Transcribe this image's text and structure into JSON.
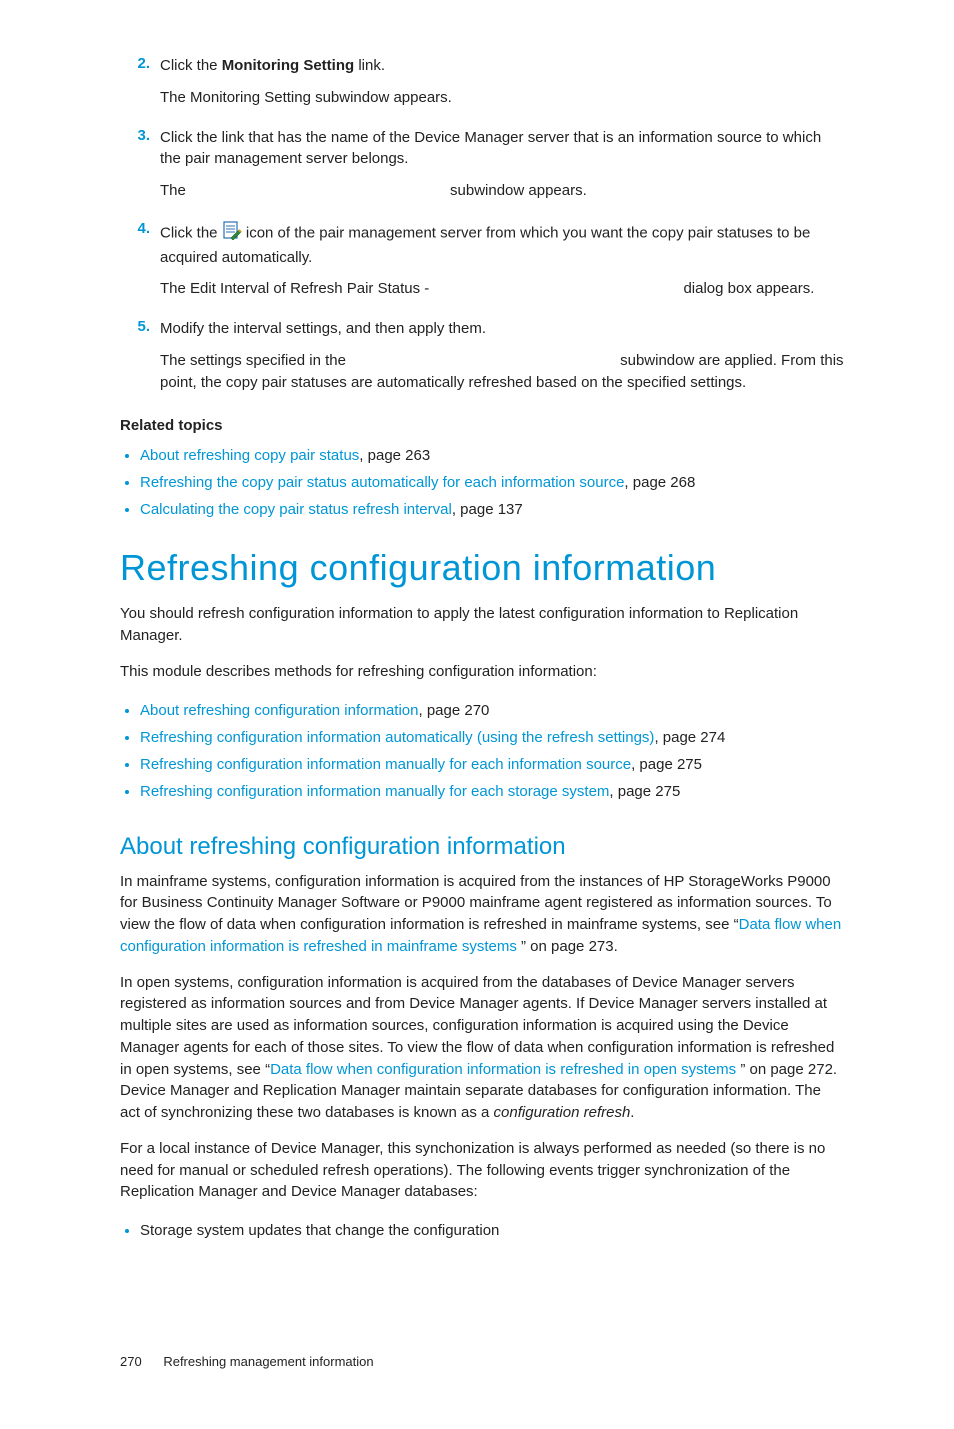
{
  "steps": {
    "s2": {
      "num": "2.",
      "line1a": "Click the ",
      "line1b": "Monitoring Setting",
      "line1c": " link.",
      "line2": "The Monitoring Setting subwindow appears."
    },
    "s3": {
      "num": "3.",
      "line1": "Click the link that has the name of the Device Manager server that is an information source to which the pair management server belongs.",
      "line2a": "The ",
      "line2b": "subwindow appears."
    },
    "s4": {
      "num": "4.",
      "line1a": "Click the ",
      "line1b": " icon of the pair management server from which you want the copy pair statuses to be acquired automatically.",
      "line2a": "The Edit Interval of Refresh Pair Status - ",
      "line2b": "dialog box appears."
    },
    "s5": {
      "num": "5.",
      "line1": "Modify the interval settings, and then apply them.",
      "line2a": "The settings specified in the ",
      "line2b": "subwindow are applied. From this point, the copy pair statuses are automatically refreshed based on the specified settings."
    }
  },
  "related": {
    "heading": "Related topics",
    "items": [
      {
        "text": "About refreshing copy pair status",
        "page": ", page 263"
      },
      {
        "text": "Refreshing the copy pair status automatically for each information source",
        "page": ", page 268"
      },
      {
        "text": "Calculating the copy pair status refresh interval",
        "page": ", page 137"
      }
    ]
  },
  "section": {
    "title": "Refreshing configuration information",
    "p1": "You should refresh configuration information to apply the latest configuration information to Replication Manager.",
    "p2": "This module describes methods for refreshing configuration information:",
    "items": [
      {
        "text": "About refreshing configuration information",
        "page": ", page 270"
      },
      {
        "text": "Refreshing configuration information automatically (using the refresh settings)",
        "page": ", page 274"
      },
      {
        "text": "Refreshing configuration information manually for each information source",
        "page": ", page 275"
      },
      {
        "text": "Refreshing configuration information manually for each storage system",
        "page": ", page 275"
      }
    ]
  },
  "subsection": {
    "title": "About refreshing configuration information",
    "p1a": "In mainframe systems, configuration information is acquired from the instances of HP StorageWorks P9000 for Business Continuity Manager Software or P9000 mainframe agent registered as information sources. To view the flow of data when configuration information is refreshed in mainframe systems, see “",
    "p1link": "Data flow when configuration information is refreshed in mainframe systems ",
    "p1b": "” on page 273.",
    "p2a": "In open systems, configuration information is acquired from the databases of Device Manager servers registered as information sources and from Device Manager agents. If Device Manager servers installed at multiple sites are used as information sources, configuration information is acquired using the Device Manager agents for each of those sites. To view the flow of data when configuration information is refreshed in open systems, see “",
    "p2link": "Data flow when configuration information is refreshed in open systems  ",
    "p2b": "” on page 272. Device Manager and Replication Manager maintain separate databases for configuration information. The act of synchronizing these two databases is known as a ",
    "p2italic": "configuration refresh",
    "p2c": ".",
    "p3": "For a local instance of Device Manager, this synchonization is always performed as needed (so there is no need for manual or scheduled refresh operations). The following events trigger synchronization of the Replication Manager and Device Manager databases:",
    "bullet1": "Storage system updates that change the configuration"
  },
  "footer": {
    "page": "270",
    "title": "Refreshing management information"
  }
}
